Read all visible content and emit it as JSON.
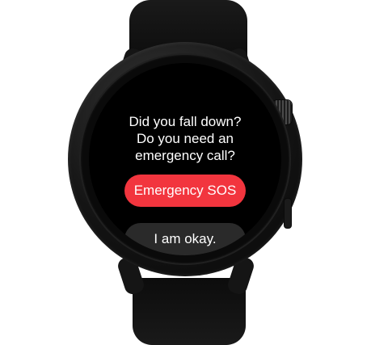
{
  "prompt": {
    "line1": "Did you fall down?",
    "line2": "Do you need an",
    "line3": "emergency call?"
  },
  "buttons": {
    "emergency_sos": "Emergency SOS",
    "i_am_okay": "I am okay."
  },
  "colors": {
    "sos_button": "#f2353e",
    "okay_button": "#2a2a2a",
    "screen_background": "#000000",
    "text": "#ffffff"
  }
}
